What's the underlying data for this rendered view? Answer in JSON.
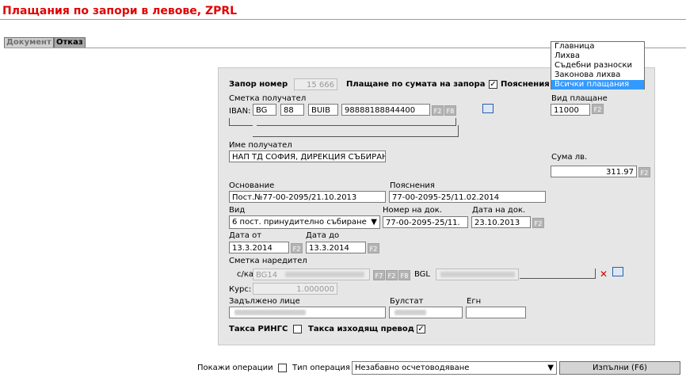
{
  "header": {
    "title": "Плащания по запори в левове, ZPRL"
  },
  "tabs": {
    "document": "Документ",
    "cancel": "Отказ"
  },
  "form": {
    "zapor_label": "Запор номер",
    "zapor_value": "15 666",
    "pay_by_amount_label": "Плащане по сумата на запора",
    "explanations_check_label": "Пояснения",
    "account_recipient_label": "Сметка получател",
    "iban_label": "IBAN:",
    "iban_country": "BG",
    "iban_check": "88",
    "iban_bank": "BUIB",
    "iban_account": "98888188844400",
    "payment_type_label": "Вид плащане",
    "payment_type_value": "11000",
    "recipient_name_label": "Име получател",
    "recipient_name_value": "НАП ТД СОФИЯ, ДИРЕКЦИЯ СЪБИРАН",
    "amount_label": "Сума лв.",
    "amount_value": "311.97",
    "basis_label": "Основание",
    "basis_value": "Пост.№77-00-2095/21.10.2013",
    "explanations_label": "Пояснения",
    "explanations_value": "77-00-2095-25/11.02.2014",
    "kind_label": "Вид",
    "kind_value": "6 пост. принудително събиране",
    "doc_number_label": "Номер на док.",
    "doc_number_value": "77-00-2095-25/11.",
    "doc_date_label": "Дата на док.",
    "doc_date_value": "23.10.2013",
    "date_from_label": "Дата от",
    "date_from_value": "13.3.2014",
    "date_to_label": "Дата до",
    "date_to_value": "13.3.2014",
    "orderer_account_label": "Сметка наредител",
    "account_prefix_label": "с/ка:",
    "account_value": "BG14",
    "currency": "BGL",
    "rate_label": "Курс:",
    "rate_value": "1.000000",
    "obligated_label": "Задължено лице",
    "bulstat_label": "Булстат",
    "egn_label": "Егн",
    "fee_rings_label": "Такса РИНГС",
    "fee_outgoing_label": "Такса изходящ превод",
    "keys": {
      "f2": "F2",
      "f7": "F7",
      "f8": "F8"
    }
  },
  "dropdown": {
    "items": [
      "Главница",
      "Лихва",
      "Съдебни разноски",
      "Законова лихва",
      "Всички плащания"
    ],
    "selected_index": 4
  },
  "footer": {
    "show_ops_label": "Покажи операции",
    "op_type_label": "Тип операция",
    "op_type_value": "Незабавно осчетоводяване",
    "execute_label": "Изпълни (F6)"
  },
  "colors": {
    "title": "#e00000",
    "panel": "#e6e6e6",
    "highlight": "#3399ff",
    "close": "#cc0000"
  }
}
